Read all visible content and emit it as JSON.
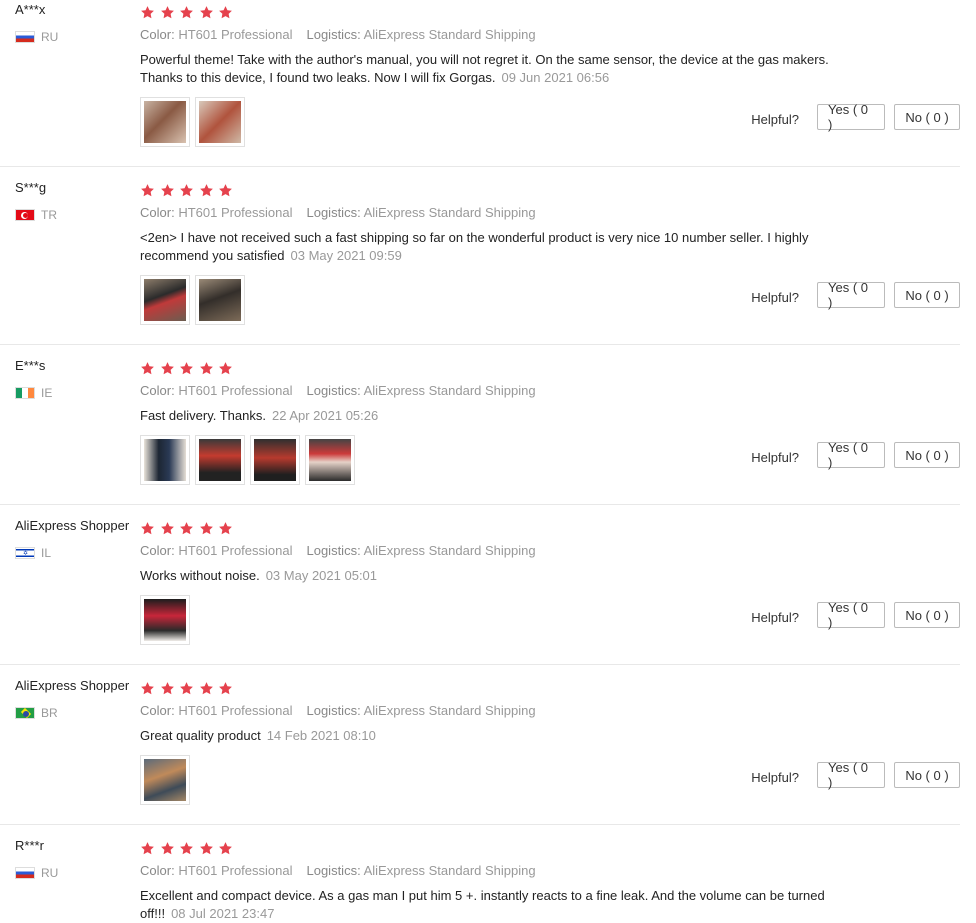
{
  "labels": {
    "color": "Color:",
    "logistics": "Logistics:",
    "helpful": "Helpful?"
  },
  "reviews": [
    {
      "user": "A***x",
      "country": "RU",
      "flag_icon": "russia-flag-icon",
      "rating": 5,
      "color_value": "HT601 Professional",
      "logistics_value": "AliExpress Standard Shipping",
      "text": "Powerful theme! Take with the author's manual, you will not regret it. On the same sensor, the device at the gas makers. Thanks to this device, I found two leaks. Now I will fix Gorgas.",
      "date": "09 Jun 2021 06:56",
      "image_count": 2,
      "yes": "Yes ( 0 )",
      "no": "No ( 0 )"
    },
    {
      "user": "S***g",
      "country": "TR",
      "flag_icon": "turkey-flag-icon",
      "rating": 5,
      "color_value": "HT601 Professional",
      "logistics_value": "AliExpress Standard Shipping",
      "text": "<2en> I have not received such a fast shipping so far on the wonderful product is very nice 10 number seller. I highly recommend you satisfied",
      "date": "03 May 2021 09:59",
      "image_count": 2,
      "yes": "Yes ( 0 )",
      "no": "No ( 0 )"
    },
    {
      "user": "E***s",
      "country": "IE",
      "flag_icon": "ireland-flag-icon",
      "rating": 5,
      "color_value": "HT601 Professional",
      "logistics_value": "AliExpress Standard Shipping",
      "text": "Fast delivery. Thanks.",
      "date": "22 Apr 2021 05:26",
      "image_count": 4,
      "yes": "Yes ( 0 )",
      "no": "No ( 0 )"
    },
    {
      "user": "AliExpress Shopper",
      "country": "IL",
      "flag_icon": "israel-flag-icon",
      "rating": 5,
      "color_value": "HT601 Professional",
      "logistics_value": "AliExpress Standard Shipping",
      "text": "Works without noise.",
      "date": "03 May 2021 05:01",
      "image_count": 1,
      "yes": "Yes ( 0 )",
      "no": "No ( 0 )"
    },
    {
      "user": "AliExpress Shopper",
      "country": "BR",
      "flag_icon": "brazil-flag-icon",
      "rating": 5,
      "color_value": "HT601 Professional",
      "logistics_value": "AliExpress Standard Shipping",
      "text": "Great quality product",
      "date": "14 Feb 2021 08:10",
      "image_count": 1,
      "yes": "Yes ( 0 )",
      "no": "No ( 0 )"
    },
    {
      "user": "R***r",
      "country": "RU",
      "flag_icon": "russia-flag-icon",
      "rating": 5,
      "color_value": "HT601 Professional",
      "logistics_value": "AliExpress Standard Shipping",
      "text": "Excellent and compact device. As a gas man I put him 5 +. instantly reacts to a fine leak. And the volume can be turned off!!!",
      "date": "08 Jul 2021 23:47",
      "image_count": 0
    }
  ],
  "colors": {
    "star": "#e5424d",
    "muted": "#999999",
    "divider": "#e8e8e8"
  }
}
